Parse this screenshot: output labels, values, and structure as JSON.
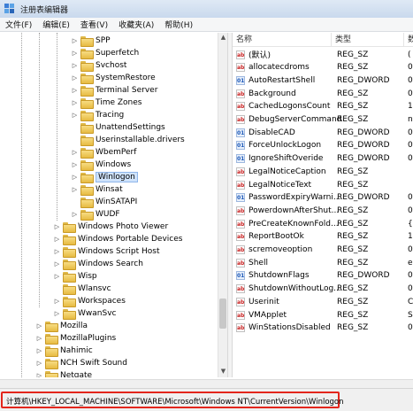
{
  "window": {
    "title": "注册表编辑器"
  },
  "menu": [
    "文件(F)",
    "编辑(E)",
    "查看(V)",
    "收藏夹(A)",
    "帮助(H)"
  ],
  "tree": [
    {
      "label": "SPP",
      "level": 2,
      "expander": "▷"
    },
    {
      "label": "Superfetch",
      "level": 2,
      "expander": "▷"
    },
    {
      "label": "Svchost",
      "level": 2,
      "expander": "▷"
    },
    {
      "label": "SystemRestore",
      "level": 2,
      "expander": "▷"
    },
    {
      "label": "Terminal Server",
      "level": 2,
      "expander": "▷"
    },
    {
      "label": "Time Zones",
      "level": 2,
      "expander": "▷"
    },
    {
      "label": "Tracing",
      "level": 2,
      "expander": "▷"
    },
    {
      "label": "UnattendSettings",
      "level": 2,
      "expander": ""
    },
    {
      "label": "Userinstallable.drivers",
      "level": 2,
      "expander": ""
    },
    {
      "label": "WbemPerf",
      "level": 2,
      "expander": "▷"
    },
    {
      "label": "Windows",
      "level": 2,
      "expander": "▷"
    },
    {
      "label": "Winlogon",
      "level": 2,
      "expander": "▷",
      "selected": true
    },
    {
      "label": "Winsat",
      "level": 2,
      "expander": "▷"
    },
    {
      "label": "WinSATAPI",
      "level": 2,
      "expander": ""
    },
    {
      "label": "WUDF",
      "level": 2,
      "expander": "▷"
    },
    {
      "label": "Windows Photo Viewer",
      "level": 1,
      "expander": "▷"
    },
    {
      "label": "Windows Portable Devices",
      "level": 1,
      "expander": "▷"
    },
    {
      "label": "Windows Script Host",
      "level": 1,
      "expander": "▷"
    },
    {
      "label": "Windows Search",
      "level": 1,
      "expander": "▷"
    },
    {
      "label": "Wisp",
      "level": 1,
      "expander": "▷"
    },
    {
      "label": "Wlansvc",
      "level": 1,
      "expander": ""
    },
    {
      "label": "Workspaces",
      "level": 1,
      "expander": "▷"
    },
    {
      "label": "WwanSvc",
      "level": 1,
      "expander": "▷"
    },
    {
      "label": "Mozilla",
      "level": 0,
      "expander": "▷"
    },
    {
      "label": "MozillaPlugins",
      "level": 0,
      "expander": "▷"
    },
    {
      "label": "Nahimic",
      "level": 0,
      "expander": "▷"
    },
    {
      "label": "NCH Swift Sound",
      "level": 0,
      "expander": "▷"
    },
    {
      "label": "Netgate",
      "level": 0,
      "expander": "▷"
    }
  ],
  "columns": {
    "name": "名称",
    "type": "类型",
    "data": "数据"
  },
  "values": [
    {
      "name": "(默认)",
      "type": "REG_SZ",
      "data": "(",
      "kind": "sz"
    },
    {
      "name": "allocatecdroms",
      "type": "REG_SZ",
      "data": "0",
      "kind": "sz"
    },
    {
      "name": "AutoRestartShell",
      "type": "REG_DWORD",
      "data": "0",
      "kind": "dw"
    },
    {
      "name": "Background",
      "type": "REG_SZ",
      "data": "0",
      "kind": "sz"
    },
    {
      "name": "CachedLogonsCount",
      "type": "REG_SZ",
      "data": "1",
      "kind": "sz"
    },
    {
      "name": "DebugServerCommand",
      "type": "REG_SZ",
      "data": "n",
      "kind": "sz"
    },
    {
      "name": "DisableCAD",
      "type": "REG_DWORD",
      "data": "0",
      "kind": "dw"
    },
    {
      "name": "ForceUnlockLogon",
      "type": "REG_DWORD",
      "data": "0",
      "kind": "dw"
    },
    {
      "name": "IgnoreShiftOveride",
      "type": "REG_DWORD",
      "data": "0",
      "kind": "dw"
    },
    {
      "name": "LegalNoticeCaption",
      "type": "REG_SZ",
      "data": "",
      "kind": "sz"
    },
    {
      "name": "LegalNoticeText",
      "type": "REG_SZ",
      "data": "",
      "kind": "sz"
    },
    {
      "name": "PasswordExpiryWarni...",
      "type": "REG_DWORD",
      "data": "0",
      "kind": "dw"
    },
    {
      "name": "PowerdownAfterShut...",
      "type": "REG_SZ",
      "data": "0",
      "kind": "sz"
    },
    {
      "name": "PreCreateKnownFold...",
      "type": "REG_SZ",
      "data": "{",
      "kind": "sz"
    },
    {
      "name": "ReportBootOk",
      "type": "REG_SZ",
      "data": "1",
      "kind": "sz"
    },
    {
      "name": "scremoveoption",
      "type": "REG_SZ",
      "data": "0",
      "kind": "sz"
    },
    {
      "name": "Shell",
      "type": "REG_SZ",
      "data": "e",
      "kind": "sz"
    },
    {
      "name": "ShutdownFlags",
      "type": "REG_DWORD",
      "data": "0",
      "kind": "dw"
    },
    {
      "name": "ShutdownWithoutLog...",
      "type": "REG_SZ",
      "data": "0",
      "kind": "sz"
    },
    {
      "name": "Userinit",
      "type": "REG_SZ",
      "data": "C",
      "kind": "sz"
    },
    {
      "name": "VMApplet",
      "type": "REG_SZ",
      "data": "S",
      "kind": "sz"
    },
    {
      "name": "WinStationsDisabled",
      "type": "REG_SZ",
      "data": "0",
      "kind": "sz"
    }
  ],
  "status": {
    "path": "计算机\\HKEY_LOCAL_MACHINE\\SOFTWARE\\Microsoft\\Windows NT\\CurrentVersion\\Winlogon"
  },
  "icons": {
    "string_value": "ab-string-icon",
    "dword_value": "binary-dword-icon",
    "folder": "folder-icon"
  }
}
